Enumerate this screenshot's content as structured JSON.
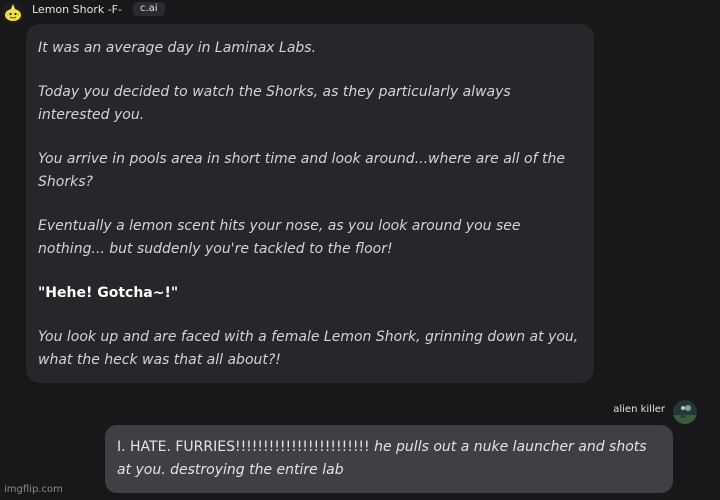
{
  "character": {
    "name": "Lemon Shork -F-",
    "badge": "c.ai",
    "avatar_icon": "lemon-shork-icon"
  },
  "bot_message": {
    "paragraphs": [
      "It was an average day in Laminax Labs.",
      "Today you decided to watch the Shorks, as they particularly always interested you.",
      "You arrive in pools area in short time and look around...where are all of the Shorks?",
      "Eventually a lemon scent hits your nose, as you look around you see nothing... but suddenly you're tackled to the floor!",
      "\"Hehe! Gotcha~!\"",
      "You look up and are faced with a female Lemon Shork, grinning down at you, what the heck was that all about?!"
    ]
  },
  "user": {
    "name": "alien killer",
    "avatar_icon": "user-avatar-icon"
  },
  "user_message": {
    "shout": "I. HATE. FURRIES!!!!!!!!!!!!!!!!!!!!!!!!",
    "action": "he pulls out a nuke launcher and shots at you. destroying the entire lab"
  },
  "watermark": "imgflip.com",
  "colors": {
    "background": "#18181b",
    "bot_bubble": "#26272b",
    "user_bubble": "#3f3f46",
    "text": "#e4e4e7"
  }
}
